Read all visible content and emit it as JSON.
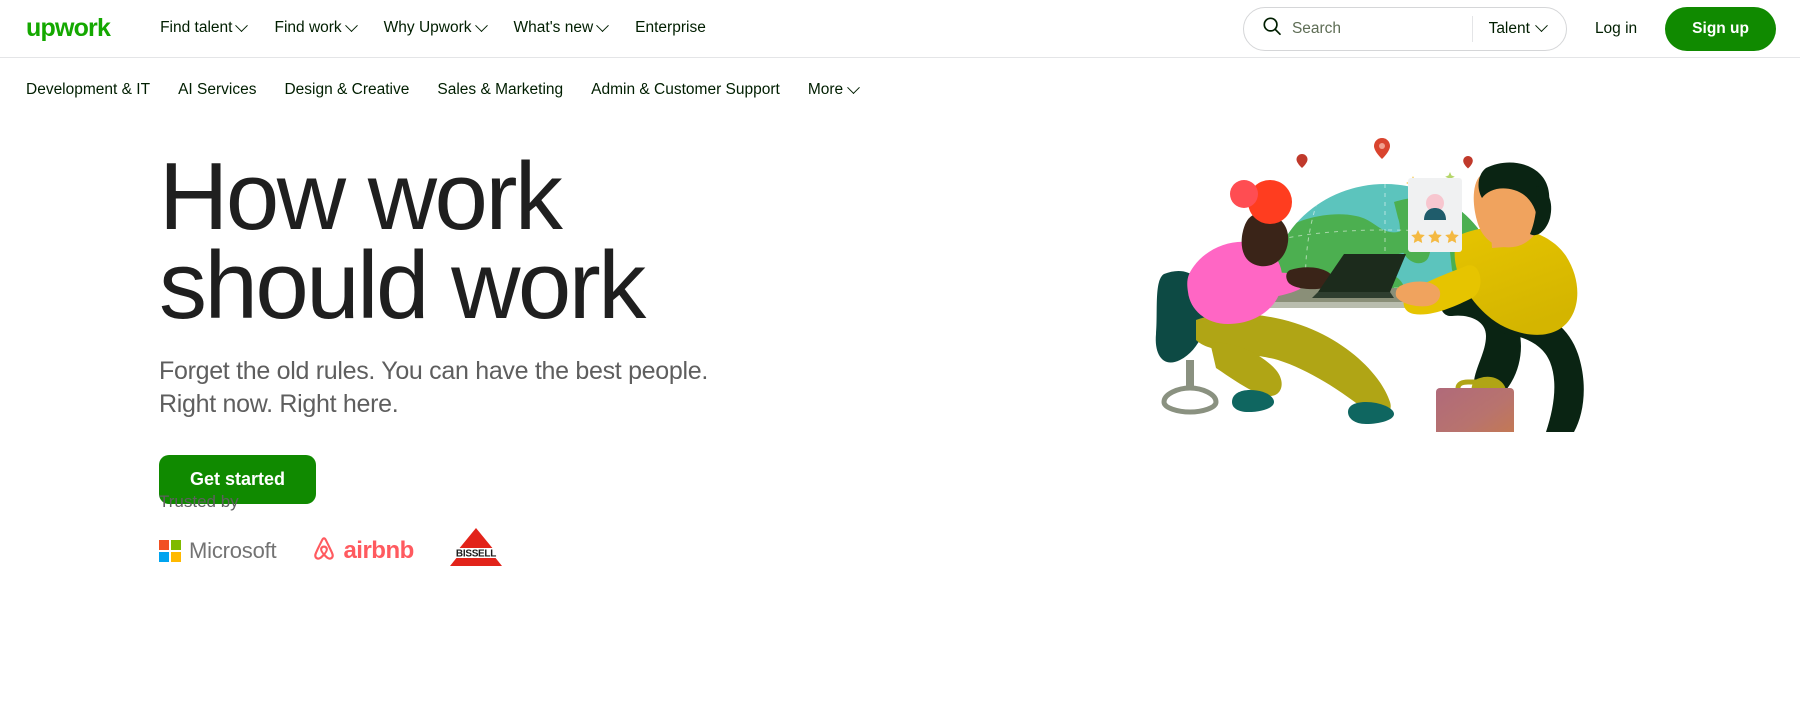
{
  "brand": {
    "logo_text": "upwork",
    "logo_color": "#14a800"
  },
  "top_nav": {
    "links": [
      {
        "label": "Find talent",
        "has_caret": true
      },
      {
        "label": "Find work",
        "has_caret": true
      },
      {
        "label": "Why Upwork",
        "has_caret": true
      },
      {
        "label": "What's new",
        "has_caret": true
      },
      {
        "label": "Enterprise",
        "has_caret": false
      }
    ],
    "search": {
      "placeholder": "Search",
      "value": "",
      "icon": "search-icon",
      "scope_label": "Talent",
      "scope_caret": "chevron-down-icon"
    },
    "login_label": "Log in",
    "signup_label": "Sign up",
    "signup_color": "#108a00"
  },
  "category_nav": {
    "items": [
      {
        "label": "Development & IT",
        "has_caret": false
      },
      {
        "label": "AI Services",
        "has_caret": false
      },
      {
        "label": "Design & Creative",
        "has_caret": false
      },
      {
        "label": "Sales & Marketing",
        "has_caret": false
      },
      {
        "label": "Admin & Customer Support",
        "has_caret": false
      },
      {
        "label": "More",
        "has_caret": true
      }
    ]
  },
  "hero": {
    "title": "How work\nshould work",
    "subtitle": "Forget the old rules. You can have the best people.\nRight now. Right here.",
    "cta_label": "Get started",
    "cta_color": "#108a00",
    "trusted_label": "Trusted by",
    "trusted_logos": [
      {
        "name": "Microsoft",
        "word": "Microsoft",
        "colors": [
          "#f25022",
          "#7fba00",
          "#00a4ef",
          "#ffb900"
        ],
        "word_color": "#737373"
      },
      {
        "name": "Airbnb",
        "word": "airbnb",
        "color": "#ff5a5f"
      },
      {
        "name": "Bissell",
        "word": "BISSELL",
        "color": "#e2231a"
      }
    ],
    "illustration_alt": "Two people working: a person seated in an office chair using a laptop, and a standing person holding a rated freelancer profile card in front of a globe"
  }
}
